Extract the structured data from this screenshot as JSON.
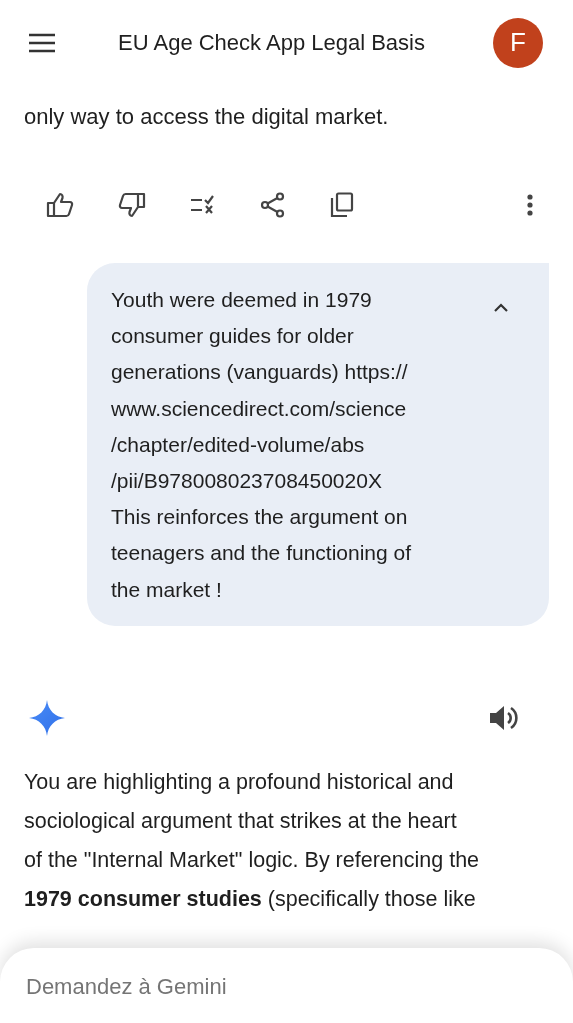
{
  "header": {
    "title": "EU Age Check App Legal Basis",
    "avatar": "F"
  },
  "previous_response": {
    "text": "only way to access the digital market.",
    "actions": [
      {
        "kind": "thumbs-up"
      },
      {
        "kind": "thumbs-down"
      },
      {
        "kind": "double-check"
      },
      {
        "kind": "share"
      },
      {
        "kind": "copy"
      },
      {
        "kind": "more"
      }
    ]
  },
  "user_message": {
    "expanded": true,
    "lines": [
      "Youth were deemed in 1979",
      "consumer guides for older",
      "generations (vanguards) https://",
      "www.sciencedirect.com/science",
      "/chapter/edited-volume/abs",
      "/pii/B978008023708450020X",
      "This reinforces the argument on",
      "teenagers and the functioning of",
      "the market !"
    ]
  },
  "response": {
    "lines": [
      "You are highlighting a profound historical and",
      "sociological argument that strikes at the heart",
      "of the \"Internal Market\" logic. By referencing the",
      "**1979 consumer studies** (specifically those like"
    ]
  },
  "input": {
    "placeholder": "Demandez à Gemini"
  }
}
